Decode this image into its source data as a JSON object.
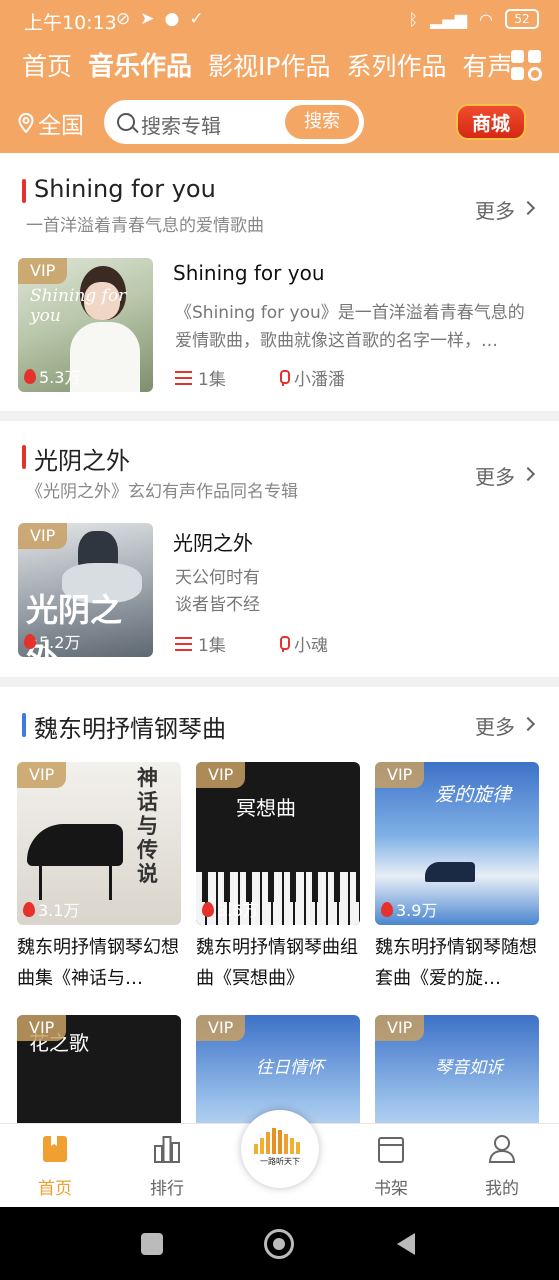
{
  "status_bar": {
    "time": "上午10:13",
    "battery": "52"
  },
  "tabs": [
    {
      "label": "首页",
      "active": false
    },
    {
      "label": "音乐作品",
      "active": true
    },
    {
      "label": "影视IP作品",
      "active": false
    },
    {
      "label": "系列作品",
      "active": false
    },
    {
      "label": "有声",
      "active": false
    }
  ],
  "search": {
    "location": "全国",
    "placeholder": "搜索专辑",
    "button": "搜索",
    "mall_label": "商城"
  },
  "sections": [
    {
      "title": "Shining for you",
      "subtitle": "一首洋溢着青春气息的爱情歌曲",
      "more": "更多",
      "accent": "#e5322d",
      "item": {
        "title": "Shining for you",
        "desc": "《Shining for you》是一首洋溢着青春气息的爱情歌曲，歌曲就像这首歌的名字一样，…",
        "vip": "VIP",
        "plays": "5.3万",
        "episodes": "1集",
        "author": "小潘潘",
        "cover_text": "Shining for you"
      }
    },
    {
      "title": "光阴之外",
      "subtitle": "《光阴之外》玄幻有声作品同名专辑",
      "more": "更多",
      "accent": "#e5322d",
      "item": {
        "title": "光阴之外",
        "desc_line1": "天公何时有",
        "desc_line2": "谈者皆不经",
        "vip": "VIP",
        "plays": "5.2万",
        "episodes": "1集",
        "author": "小魂",
        "cover_text": "光阴之外"
      }
    },
    {
      "title": "魏东明抒情钢琴曲",
      "more": "更多",
      "accent": "#3c7be0",
      "grid": [
        {
          "vip": "VIP",
          "plays": "3.1万",
          "title": "魏东明抒情钢琴幻想曲集《神话与…",
          "cover_text": "神话与传说"
        },
        {
          "vip": "VIP",
          "plays": "3.6万",
          "title": "魏东明抒情钢琴曲组曲《冥想曲》",
          "cover_text": "冥想曲"
        },
        {
          "vip": "VIP",
          "plays": "3.9万",
          "title": "魏东明抒情钢琴随想套曲《爱的旋…",
          "cover_text": "爱的旋律"
        },
        {
          "vip": "VIP",
          "cover_text": "花之歌"
        },
        {
          "vip": "VIP",
          "cover_text": "往日情怀"
        },
        {
          "vip": "VIP",
          "cover_text": "琴音如诉"
        }
      ]
    }
  ],
  "bottom_nav": [
    {
      "label": "首页",
      "active": true
    },
    {
      "label": "排行",
      "active": false
    },
    {
      "label": "书架",
      "active": false
    },
    {
      "label": "我的",
      "active": false
    }
  ],
  "logo_text": "一路听天下",
  "colors": {
    "header": "#f4a665",
    "accent_red": "#e5322d",
    "active_nav": "#f0a030"
  }
}
